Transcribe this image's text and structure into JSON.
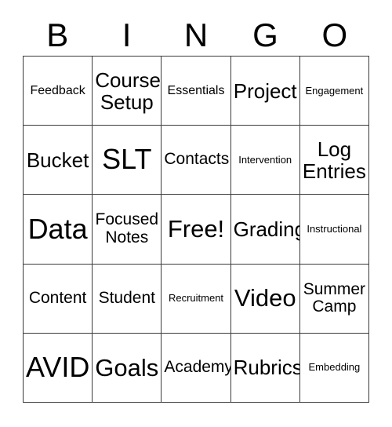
{
  "card": {
    "title": "BINGO",
    "columns": [
      "B",
      "I",
      "N",
      "G",
      "O"
    ],
    "free_space_label": "Free!",
    "grid_size": 5,
    "colors": {
      "background": "#ffffff",
      "text": "#000000",
      "border": "#3a3a3a"
    },
    "header": {
      "letters": [
        {
          "label": "B"
        },
        {
          "label": "I"
        },
        {
          "label": "N"
        },
        {
          "label": "G"
        },
        {
          "label": "O"
        }
      ]
    },
    "rows": [
      {
        "cells": [
          {
            "label": "Feedback",
            "size": "s",
            "free": false
          },
          {
            "label": "Course\nSetup",
            "size": "l",
            "free": false
          },
          {
            "label": "Essentials",
            "size": "s",
            "free": false
          },
          {
            "label": "Project",
            "size": "l",
            "free": false
          },
          {
            "label": "Engagement",
            "size": "xs",
            "free": false
          }
        ]
      },
      {
        "cells": [
          {
            "label": "Bucket",
            "size": "l",
            "free": false
          },
          {
            "label": "SLT",
            "size": "xxl",
            "free": false
          },
          {
            "label": "Contacts",
            "size": "m",
            "free": false
          },
          {
            "label": "Intervention",
            "size": "xs",
            "free": false
          },
          {
            "label": "Log\nEntries",
            "size": "l",
            "free": false
          }
        ]
      },
      {
        "cells": [
          {
            "label": "Data",
            "size": "xxl",
            "free": false
          },
          {
            "label": "Focused\nNotes",
            "size": "m",
            "free": false
          },
          {
            "label": "Free!",
            "size": "xl",
            "free": true
          },
          {
            "label": "Grading",
            "size": "l",
            "free": false
          },
          {
            "label": "Instructional",
            "size": "xs",
            "free": false
          }
        ]
      },
      {
        "cells": [
          {
            "label": "Content",
            "size": "m",
            "free": false
          },
          {
            "label": "Student",
            "size": "m",
            "free": false
          },
          {
            "label": "Recruitment",
            "size": "xs",
            "free": false
          },
          {
            "label": "Video",
            "size": "xl",
            "free": false
          },
          {
            "label": "Summer\nCamp",
            "size": "m",
            "free": false
          }
        ]
      },
      {
        "cells": [
          {
            "label": "AVID",
            "size": "xxl",
            "free": false
          },
          {
            "label": "Goals",
            "size": "xl",
            "free": false
          },
          {
            "label": "Academy",
            "size": "m",
            "free": false
          },
          {
            "label": "Rubrics",
            "size": "l",
            "free": false
          },
          {
            "label": "Embedding",
            "size": "xs",
            "free": false
          }
        ]
      }
    ]
  }
}
